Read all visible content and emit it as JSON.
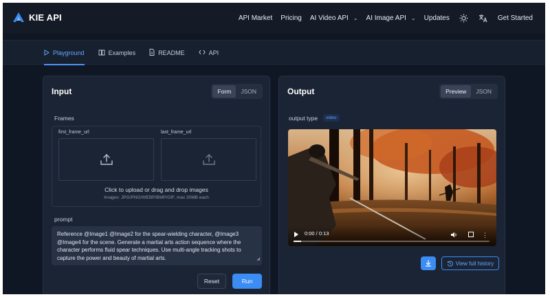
{
  "brand": {
    "name": "KIE API",
    "accent": "#3b8cf3"
  },
  "nav": {
    "items": [
      {
        "label": "API Market"
      },
      {
        "label": "Pricing"
      },
      {
        "label": "AI Video API"
      },
      {
        "label": "AI Image API"
      },
      {
        "label": "Updates"
      }
    ],
    "theme_icon": "sun-icon",
    "lang_icon": "translate-icon",
    "cta": "Get Started"
  },
  "tabs": [
    {
      "label": "Playground",
      "icon": "play-icon",
      "active": true
    },
    {
      "label": "Examples",
      "icon": "book-icon"
    },
    {
      "label": "README",
      "icon": "document-icon"
    },
    {
      "label": "API",
      "icon": "code-icon"
    }
  ],
  "input": {
    "title": "Input",
    "toggle": {
      "form": "Form",
      "json": "JSON",
      "selected": "Form"
    },
    "frames": {
      "label": "Frames",
      "first": "first_frame_url",
      "last": "last_frame_url",
      "drop_text": "Click to upload or drag and drop images",
      "drop_hint": "Images: JPG/PNG/WEBP/BMP/GIF, max 30MB each"
    },
    "prompt": {
      "label": "prompt",
      "value": "Reference @Image1 @Image2 for the spear-wielding character, @Image3 @Image4 for the scene. Generate a martial arts action sequence where the character performs fluid spear techniques. Use multi-angle tracking shots to capture the power and beauty of martial arts."
    },
    "reset": "Reset",
    "run": "Run"
  },
  "output": {
    "title": "Output",
    "toggle": {
      "preview": "Preview",
      "json": "JSON",
      "selected": "Preview"
    },
    "type_label": "output type",
    "type_value": "video",
    "video": {
      "time": "0:00 / 0:13",
      "progress": 0.04
    },
    "download_icon": "download-icon",
    "history": "View full history"
  }
}
